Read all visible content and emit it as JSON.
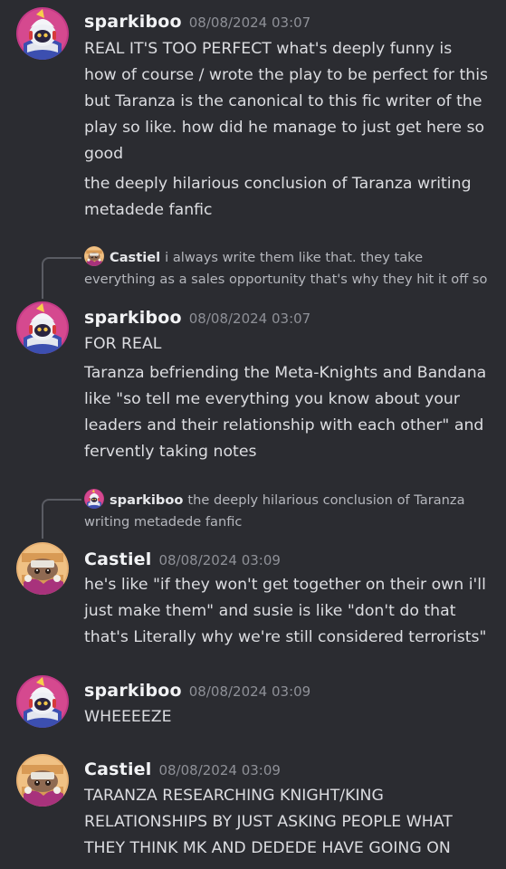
{
  "users": {
    "sparkiboo": "sparkiboo",
    "castiel": "Castiel"
  },
  "messages": [
    {
      "author": "sparkiboo",
      "timestamp": "08/08/2024 03:07",
      "lines": [
        "REAL IT'S TOO PERFECT what's deeply funny is",
        "how of course / wrote the play to be perfect for this",
        "but Taranza is the canonical to this fic writer of the",
        "play so like. how did he manage to just get here so",
        "good",
        "the deeply hilarious conclusion of Taranza writing",
        "metadede fanfic"
      ]
    },
    {
      "author": "sparkiboo",
      "timestamp": "08/08/2024 03:07",
      "reply": {
        "author": "Castiel",
        "lines": [
          "i always write them like that. they take",
          "everything as a sales opportunity that's why they hit it off so"
        ]
      },
      "lines": [
        "FOR REAL",
        "Taranza befriending the Meta-Knights and Bandana",
        "like \"so tell me everything you know about your",
        "leaders and their relationship with each other\" and",
        "fervently taking notes"
      ]
    },
    {
      "author": "Castiel",
      "timestamp": "08/08/2024 03:09",
      "reply": {
        "author": "sparkiboo",
        "lines": [
          "the deeply hilarious conclusion of Taranza",
          "writing metadede fanfic"
        ]
      },
      "lines": [
        "he's like \"if they won't get together on their own i'll",
        "just make them\" and susie is like \"don't do that",
        "that's Literally why we're still considered terrorists\""
      ]
    },
    {
      "author": "sparkiboo",
      "timestamp": "08/08/2024 03:09",
      "lines": [
        "WHEEEEZE"
      ]
    },
    {
      "author": "Castiel",
      "timestamp": "08/08/2024 03:09",
      "lines": [
        "TARANZA RESEARCHING KNIGHT/KING",
        "RELATIONSHIPS BY JUST ASKING PEOPLE WHAT",
        "THEY THINK MK AND DEDEDE HAVE GOING ON"
      ]
    }
  ],
  "colors": {
    "background": "#2b2c31",
    "username": "#f2f3f5",
    "timestamp": "#8e9097",
    "text": "#dcdde1",
    "reply_text": "#b5b7bd"
  },
  "icons": {
    "sparkiboo_avatar": "magolor-avatar-icon",
    "castiel_avatar": "taranza-avatar-icon"
  }
}
